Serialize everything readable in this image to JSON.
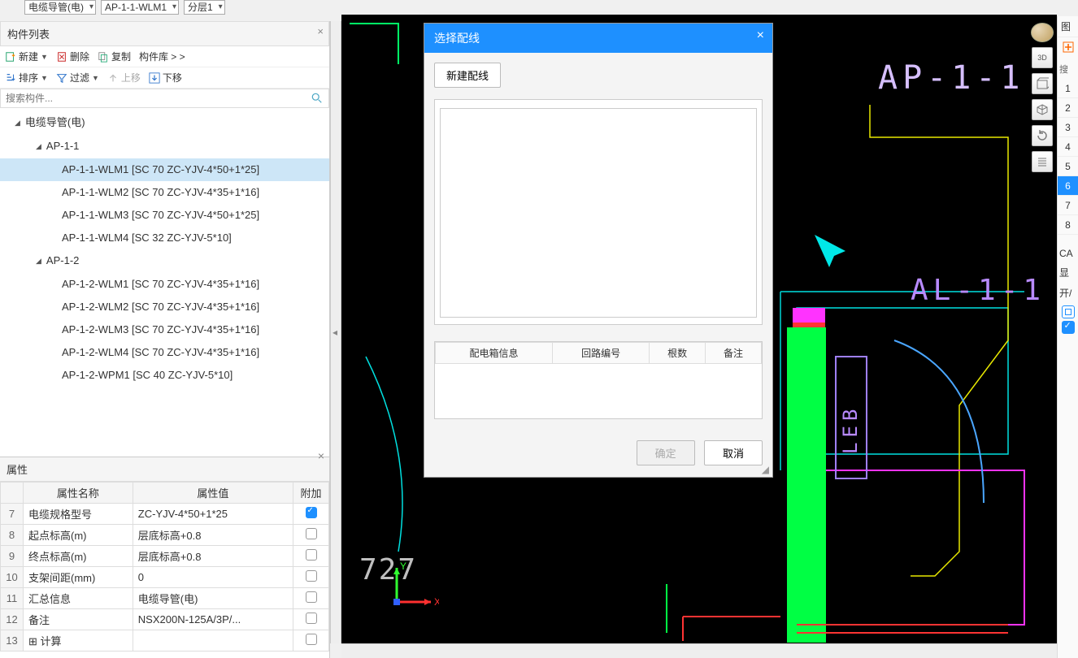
{
  "top_combos": [
    "电缆导管(电)",
    "AP-1-1-WLM1",
    "分层1"
  ],
  "component_list": {
    "title": "构件列表",
    "toolbar1": {
      "new": "新建",
      "delete": "删除",
      "copy": "复制",
      "lib": "构件库 > >"
    },
    "toolbar2": {
      "sort": "排序",
      "filter": "过滤",
      "up": "上移",
      "down": "下移"
    },
    "search_placeholder": "搜索构件...",
    "tree": [
      {
        "label": "电缆导管(电)",
        "lvl": 0,
        "exp": true
      },
      {
        "label": "AP-1-1",
        "lvl": 1,
        "exp": true
      },
      {
        "label": "AP-1-1-WLM1 [SC 70 ZC-YJV-4*50+1*25]",
        "lvl": 2,
        "sel": true
      },
      {
        "label": "AP-1-1-WLM2 [SC 70 ZC-YJV-4*35+1*16]",
        "lvl": 2
      },
      {
        "label": "AP-1-1-WLM3 [SC 70 ZC-YJV-4*50+1*25]",
        "lvl": 2
      },
      {
        "label": "AP-1-1-WLM4 [SC 32 ZC-YJV-5*10]",
        "lvl": 2
      },
      {
        "label": "AP-1-2",
        "lvl": 1,
        "exp": true
      },
      {
        "label": "AP-1-2-WLM1 [SC 70 ZC-YJV-4*35+1*16]",
        "lvl": 2
      },
      {
        "label": "AP-1-2-WLM2 [SC 70 ZC-YJV-4*35+1*16]",
        "lvl": 2
      },
      {
        "label": "AP-1-2-WLM3 [SC 70 ZC-YJV-4*35+1*16]",
        "lvl": 2
      },
      {
        "label": "AP-1-2-WLM4 [SC 70 ZC-YJV-4*35+1*16]",
        "lvl": 2
      },
      {
        "label": "AP-1-2-WPM1 [SC 40 ZC-YJV-5*10]",
        "lvl": 2
      }
    ]
  },
  "properties": {
    "title": "属性",
    "headers": {
      "name": "属性名称",
      "value": "属性值",
      "attach": "附加"
    },
    "rows": [
      {
        "num": "7",
        "name": "电缆规格型号",
        "value": "ZC-YJV-4*50+1*25",
        "checked": true
      },
      {
        "num": "8",
        "name": "起点标高(m)",
        "value": "层底标高+0.8",
        "checked": false
      },
      {
        "num": "9",
        "name": "终点标高(m)",
        "value": "层底标高+0.8",
        "checked": false
      },
      {
        "num": "10",
        "name": "支架间距(mm)",
        "value": "0",
        "checked": false
      },
      {
        "num": "11",
        "name": "汇总信息",
        "value": "电缆导管(电)",
        "checked": false
      },
      {
        "num": "12",
        "name": "备注",
        "value": "NSX200N-125A/3P/...",
        "checked": false
      },
      {
        "num": "13",
        "name": "⊞ 计算",
        "value": "",
        "checked": false
      }
    ]
  },
  "canvas": {
    "label_ap": "AP-1-1",
    "label_al": "AL-1-1",
    "label_leb": "LEB",
    "origin": "727",
    "axis_x": "X",
    "axis_y": "Y"
  },
  "right_strip": {
    "head": "图",
    "search": "搜",
    "rows": [
      "1",
      "2",
      "3",
      "4",
      "5",
      "6",
      "7",
      "8"
    ],
    "active": "6",
    "ca": "CA",
    "show": "显",
    "switch": "开/"
  },
  "modal": {
    "title": "选择配线",
    "new_btn": "新建配线",
    "columns": [
      "配电箱信息",
      "回路编号",
      "根数",
      "备注"
    ],
    "ok": "确定",
    "cancel": "取消"
  }
}
